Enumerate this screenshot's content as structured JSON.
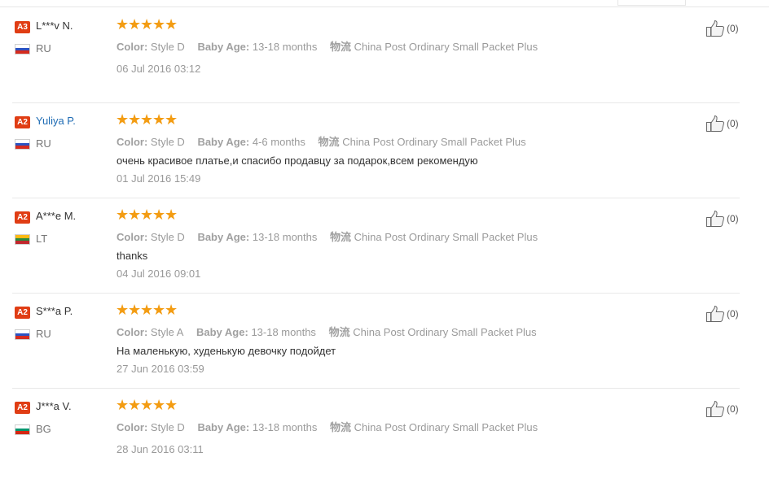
{
  "reviews": [
    {
      "level": "A3",
      "name": "L***v N.",
      "name_link": false,
      "country": "RU",
      "flag_colors": [
        "#ffffff",
        "#2b52c2",
        "#d52b1e"
      ],
      "stars": 5,
      "color_label": "Color:",
      "color_value": "Style D",
      "age_label": "Baby Age:",
      "age_value": "13-18 months",
      "ship_label": "物流",
      "ship_value": "China Post Ordinary Small Packet Plus",
      "comment": "",
      "date": "06 Jul 2016 03:12",
      "likes": "(0)"
    },
    {
      "level": "A2",
      "name": "Yuliya P.",
      "name_link": true,
      "country": "RU",
      "flag_colors": [
        "#ffffff",
        "#2b52c2",
        "#d52b1e"
      ],
      "stars": 5,
      "color_label": "Color:",
      "color_value": "Style D",
      "age_label": "Baby Age:",
      "age_value": "4-6 months",
      "ship_label": "物流",
      "ship_value": "China Post Ordinary Small Packet Plus",
      "comment": "очень красивое платье,и спасибо продавцу за подарок,всем рекомендую",
      "date": "01 Jul 2016 15:49",
      "likes": "(0)"
    },
    {
      "level": "A2",
      "name": "A***e M.",
      "name_link": false,
      "country": "LT",
      "flag_colors": [
        "#fdb913",
        "#2a8a3e",
        "#c1272d"
      ],
      "stars": 5,
      "color_label": "Color:",
      "color_value": "Style D",
      "age_label": "Baby Age:",
      "age_value": "13-18 months",
      "ship_label": "物流",
      "ship_value": "China Post Ordinary Small Packet Plus",
      "comment": "thanks",
      "date": "04 Jul 2016 09:01",
      "likes": "(0)"
    },
    {
      "level": "A2",
      "name": "S***a P.",
      "name_link": false,
      "country": "RU",
      "flag_colors": [
        "#ffffff",
        "#2b52c2",
        "#d52b1e"
      ],
      "stars": 5,
      "color_label": "Color:",
      "color_value": "Style A",
      "age_label": "Baby Age:",
      "age_value": "13-18 months",
      "ship_label": "物流",
      "ship_value": "China Post Ordinary Small Packet Plus",
      "comment": "На маленькую, худенькую девочку подойдет",
      "date": "27 Jun 2016 03:59",
      "likes": "(0)"
    },
    {
      "level": "A2",
      "name": "J***a V.",
      "name_link": false,
      "country": "BG",
      "flag_colors": [
        "#ffffff",
        "#00966e",
        "#d62612"
      ],
      "stars": 5,
      "color_label": "Color:",
      "color_value": "Style D",
      "age_label": "Baby Age:",
      "age_value": "13-18 months",
      "ship_label": "物流",
      "ship_value": "China Post Ordinary Small Packet Plus",
      "comment": "",
      "date": "28 Jun 2016 03:11",
      "likes": "(0)"
    }
  ],
  "icons": {
    "star": "star-icon",
    "like": "thumbs-up-icon"
  }
}
